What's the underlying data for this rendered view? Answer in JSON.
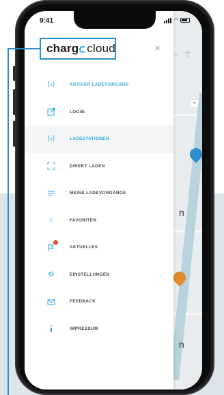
{
  "status": {
    "time": "9:41"
  },
  "brand": {
    "logo_left": "charg",
    "logo_right": "cloud",
    "accent": "#2da6dd",
    "callout": "#2d8ccb"
  },
  "drawer": {
    "close_icon": "close-icon",
    "items": [
      {
        "label": "AKTIVER LADEVORGANG",
        "icon": "charging-icon",
        "highlight": true
      },
      {
        "label": "LOGIN",
        "icon": "login-icon"
      },
      {
        "label": "LADESTATIONEN",
        "icon": "charging-stations-icon",
        "highlight": true,
        "active": true
      },
      {
        "label": "DIREKT LADEN",
        "icon": "scan-icon"
      },
      {
        "label": "MEINE LADEVORGÄNGE",
        "icon": "list-icon"
      },
      {
        "label": "FAVORITEN",
        "icon": "star-icon"
      },
      {
        "label": "AKTUELLES",
        "icon": "news-flag-icon"
      },
      {
        "label": "EINSTELLUNGEN",
        "icon": "gear-icon"
      },
      {
        "label": "FEEDBACK",
        "icon": "mail-icon"
      },
      {
        "label": "IMPRESSUM",
        "icon": "info-icon"
      }
    ]
  },
  "map": {
    "label_1": "n",
    "label_2": "n"
  }
}
